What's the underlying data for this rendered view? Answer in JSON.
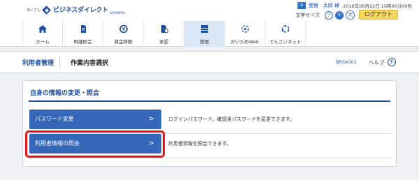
{
  "header": {
    "logo_small": "あいざん",
    "logo_text": "ビジネスダイレクト",
    "logo_sub": "SEVAMPAS",
    "user_badge": "ID",
    "user_name": "愛銀　太郎 様",
    "last_login": "2016年06月22日 10時00分00秒",
    "font_size_label": "文字サイズ",
    "font_sizes": [
      "小",
      "中",
      "大"
    ],
    "font_size_selected": "中",
    "logout_label": "ログアウト"
  },
  "nav": {
    "items": [
      {
        "label": "ホーム",
        "icon": "home-icon"
      },
      {
        "label": "明細照会",
        "icon": "document-icon"
      },
      {
        "label": "資金移動",
        "icon": "yen-transfer-icon"
      },
      {
        "label": "承認",
        "icon": "approval-icon"
      },
      {
        "label": "管理",
        "icon": "admin-icon",
        "active": true
      },
      {
        "label": "がいためWeb",
        "icon": "globe-icon"
      },
      {
        "label": "でんさいネット",
        "icon": "network-icon"
      }
    ]
  },
  "subheader": {
    "section": "利用者管理",
    "page_title": "作業内容選択",
    "screen_id": "BRSK001",
    "help_label": "ヘルプ",
    "help_icon": "?"
  },
  "panel": {
    "title": "自身の情報の変更・照会",
    "rows": [
      {
        "button": "パスワード変更",
        "chevron": ">",
        "description": "ログインパスワード、確認用パスワードを変更できます。"
      },
      {
        "button": "利用者情報の照会",
        "chevron": ">",
        "description": "利用者情報を照会できます。",
        "highlighted": true
      }
    ]
  },
  "colors": {
    "brand": "#1d4fa0",
    "button": "#3567b8",
    "logout": "#f5d65c",
    "highlight": "#e2141a"
  }
}
